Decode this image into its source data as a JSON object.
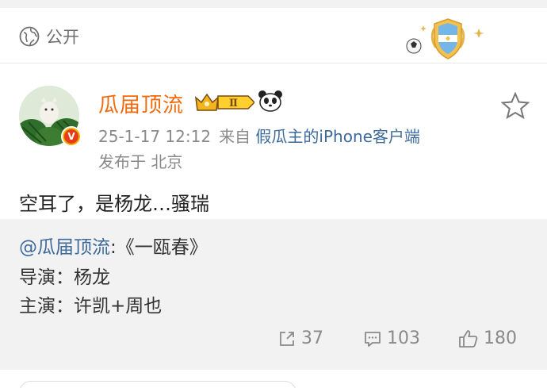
{
  "visibility": {
    "label": "公开",
    "icon": "globe-icon"
  },
  "post": {
    "username": "瓜届顶流",
    "vip_level": "Ⅱ",
    "timestamp": "25-1-17 12:12",
    "from_prefix": "来自",
    "client": "假瓜主的iPhone客户端",
    "location": "发布于 北京",
    "text": "空耳了，是杨龙…骚瑞"
  },
  "repost": {
    "mention": "@瓜届顶流",
    "title_text": ":《一瓯春》",
    "line2": "导演：杨龙",
    "line3": "主演：许凯+周也"
  },
  "stats": {
    "shares": "37",
    "comments": "103",
    "likes": "180"
  },
  "colors": {
    "username": "#f26a0c",
    "link": "#3d6a9a",
    "meta": "#8a8a8a"
  }
}
